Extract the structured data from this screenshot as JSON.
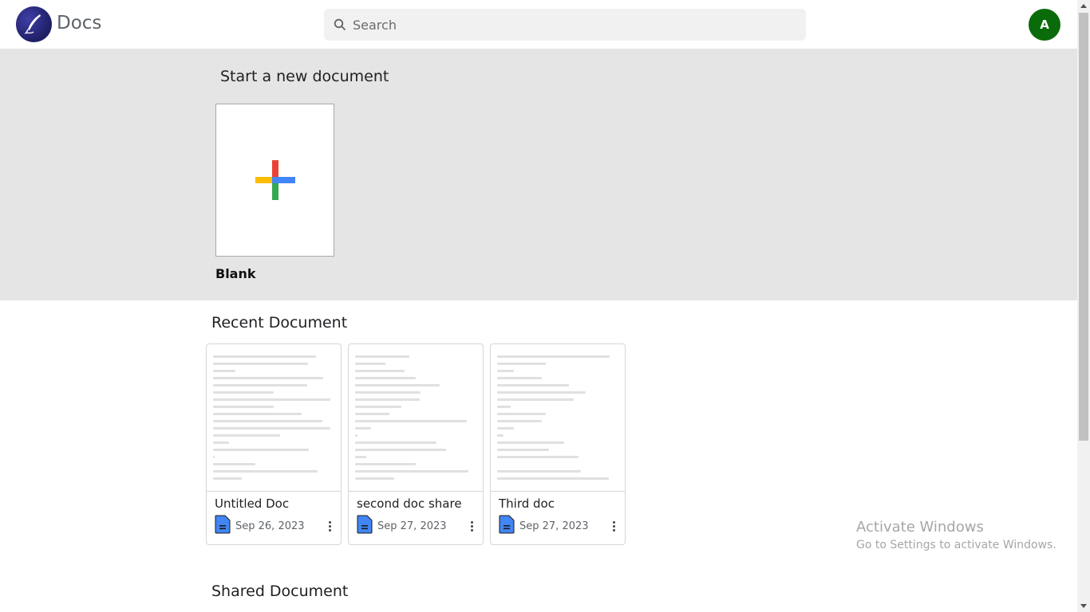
{
  "header": {
    "brand": "Docs",
    "logo_icon": "quill-pen-icon",
    "search_placeholder": "Search",
    "search_value": "",
    "avatar_initial": "A",
    "avatar_color": "#0a6b0a"
  },
  "start": {
    "title": "Start a new document",
    "blank_label": "Blank",
    "plus_colors": [
      "#ea4335",
      "#4285f4",
      "#34a853",
      "#fbbc04"
    ]
  },
  "recent": {
    "title": "Recent Document",
    "documents": [
      {
        "name": "Untitled Doc",
        "date": "Sep 26, 2023"
      },
      {
        "name": "second doc share",
        "date": "Sep 27, 2023"
      },
      {
        "name": "Third doc",
        "date": "Sep 27, 2023"
      }
    ]
  },
  "shared": {
    "title": "Shared Document"
  },
  "watermark": {
    "title": "Activate Windows",
    "subtitle": "Go to Settings to activate Windows."
  },
  "colors": {
    "doc_icon": "#4285f4",
    "section_bg": "#e5e5e5"
  }
}
